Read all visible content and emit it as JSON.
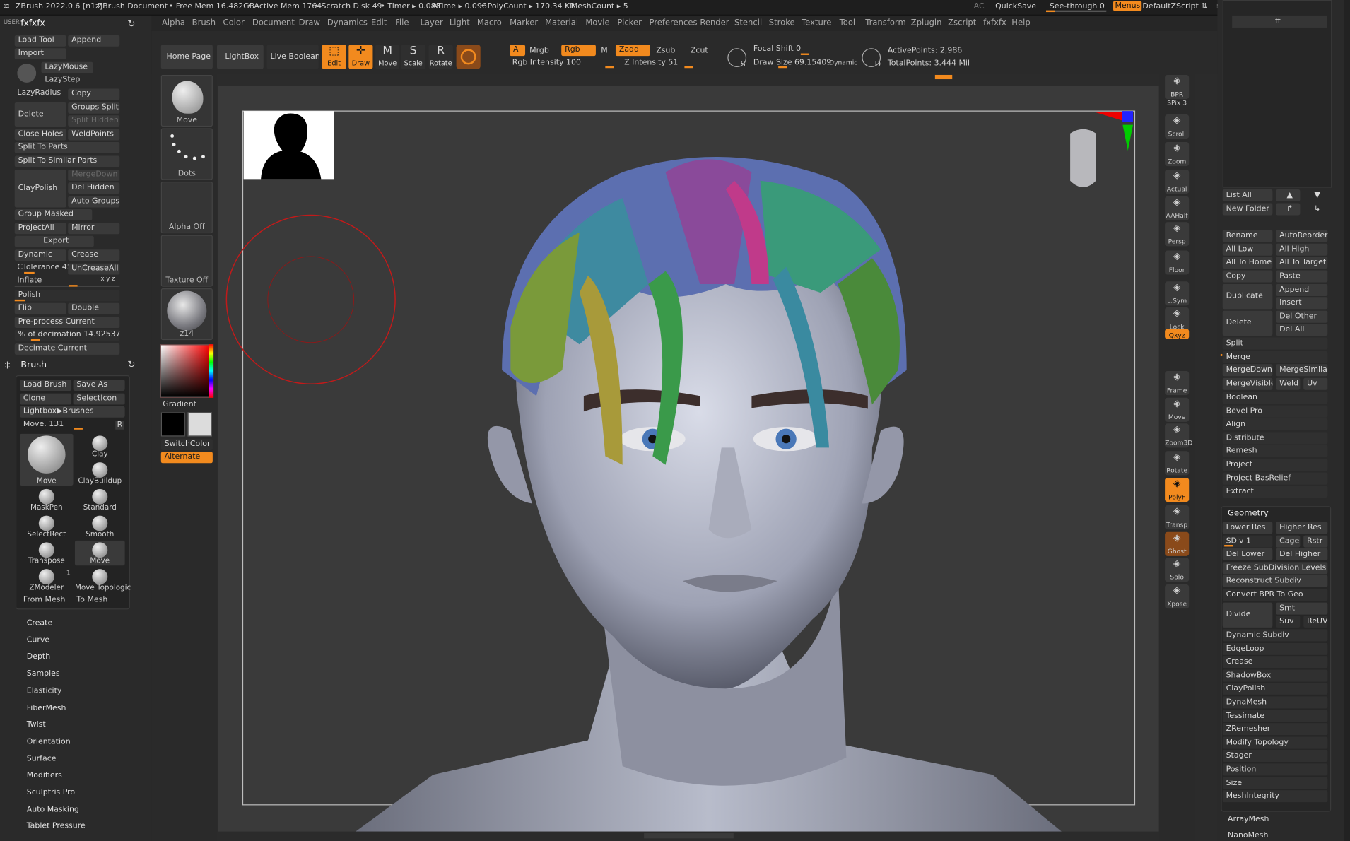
{
  "titlebar": {
    "app": "ZBrush 2022.0.6 [n1z]",
    "doc": "ZBrush Document",
    "free_mem": "• Free Mem 16.482GB",
    "active_mem": "• Active Mem 1764",
    "scratch": "• Scratch Disk 49",
    "timer": "• Timer ▸ 0.088",
    "atime": "ATime ▸ 0.096",
    "polycount": "• PolyCount ▸ 170.34 KP",
    "meshcount": "• MeshCount ▸ 5",
    "ac": "AC",
    "quicksave": "QuickSave",
    "see_through": "See-through   0",
    "menus": "Menus",
    "default_script": "DefaultZScript"
  },
  "menu": [
    "Alpha",
    "Brush",
    "Color",
    "Document",
    "Draw",
    "Dynamics",
    "Edit",
    "File",
    "Layer",
    "Light",
    "Macro",
    "Marker",
    "Material",
    "Movie",
    "Picker",
    "Preferences",
    "Render",
    "Stencil",
    "Stroke",
    "Texture",
    "Tool",
    "Transform",
    "Zplugin",
    "Zscript",
    "fxfxfx",
    "Help"
  ],
  "left": {
    "user": "USER",
    "title": "fxfxfx",
    "load_tool": "Load Tool",
    "append": "Append",
    "import": "Import",
    "lazymouse": "LazyMouse",
    "lazystep": "LazyStep",
    "lazyradius": "LazyRadius",
    "copy": "Copy",
    "delete": "Delete",
    "groups_split": "Groups Split",
    "split_hidden": "Split Hidden",
    "close_holes": "Close Holes",
    "weldpoints": "WeldPoints",
    "split_to_parts": "Split To Parts",
    "split_similar": "Split To Similar Parts",
    "claypolish": "ClayPolish",
    "mergedown": "MergeDown",
    "del_hidden": "Del Hidden",
    "auto_groups": "Auto Groups",
    "group_masked": "Group Masked",
    "projectall": "ProjectAll",
    "mirror": "Mirror",
    "export": "Export",
    "dynamic": "Dynamic",
    "crease": "Crease",
    "ctolerance": "CTolerance 45",
    "uncreaseall": "UnCreaseAll",
    "inflate": "Inflate",
    "xyz": "x y z",
    "polish": "Polish",
    "flip": "Flip",
    "double": "Double",
    "preprocess": "Pre-process Current",
    "decimation": "% of decimation  14.92537",
    "decimate": "Decimate Current",
    "brush": "Brush",
    "load_brush": "Load Brush",
    "save_as": "Save As",
    "clone": "Clone",
    "selecticon": "SelectIcon",
    "lightbox_brushes": "Lightbox▶Brushes",
    "move_val": "Move.  131",
    "r": "R",
    "from_mesh": "From Mesh",
    "to_mesh": "To Mesh",
    "brushes": [
      {
        "name": "Move",
        "icon": "move-brush-icon"
      },
      {
        "name": "Clay",
        "icon": "clay-brush-icon"
      },
      {
        "name": "ClayBuildup",
        "icon": "claybuildup-brush-icon"
      },
      {
        "name": "MaskPen",
        "icon": "maskpen-brush-icon"
      },
      {
        "name": "Standard",
        "icon": "standard-brush-icon"
      },
      {
        "name": "SelectRect",
        "icon": "selectrect-brush-icon"
      },
      {
        "name": "Smooth",
        "icon": "smooth-brush-icon"
      },
      {
        "name": "Transpose",
        "icon": "transpose-brush-icon"
      },
      {
        "name": "Move",
        "icon": "move-brush-icon"
      },
      {
        "name": "ZModeler",
        "icon": "zmodeler-brush-icon"
      },
      {
        "name": "Move Topologic",
        "icon": "move-topologic-brush-icon"
      }
    ],
    "zmodeler_count": "1",
    "subs": [
      "Create",
      "Curve",
      "Depth",
      "Samples",
      "Elasticity",
      "FiberMesh",
      "Twist",
      "Orientation",
      "Surface",
      "Modifiers",
      "Sculptris Pro",
      "Auto Masking",
      "Tablet Pressure"
    ]
  },
  "tray": {
    "move": "Move",
    "dots": "Dots",
    "alpha_off": "Alpha Off",
    "texture_off": "Texture Off",
    "z14": "z14",
    "gradient": "Gradient",
    "switchcolor": "SwitchColor",
    "alternate": "Alternate"
  },
  "tools": {
    "home_page": "Home Page",
    "lightbox": "LightBox",
    "live_boolean": "Live Boolean",
    "edit": "Edit",
    "draw": "Draw",
    "move": "Move",
    "scale": "Scale",
    "rotate": "Rotate",
    "a": "A",
    "mrgb": "Mrgb",
    "rgb": "Rgb",
    "m": "M",
    "zadd": "Zadd",
    "zsub": "Zsub",
    "zcut": "Zcut",
    "rgb_intensity": "Rgb Intensity 100",
    "z_intensity": "Z Intensity 51",
    "focal_shift": "Focal Shift 0",
    "draw_size": "Draw Size 69.15409",
    "dynamic": "Dynamic",
    "active_points": "ActivePoints: 2,986",
    "total_points": "TotalPoints: 3.444 Mil",
    "s": "S",
    "d": "D"
  },
  "shelf": [
    {
      "label": "BPR",
      "sub": "SPix 3"
    },
    {
      "label": "Scroll"
    },
    {
      "label": "Zoom"
    },
    {
      "label": "Actual"
    },
    {
      "label": "AAHalf"
    },
    {
      "label": "Persp"
    },
    {
      "label": "Floor"
    },
    {
      "label": "L.Sym"
    },
    {
      "label": "Lock"
    },
    {
      "label": "Qxyz"
    },
    {
      "label": "Frame"
    },
    {
      "label": "Move"
    },
    {
      "label": "Zoom3D"
    },
    {
      "label": "Rotate"
    },
    {
      "label": "PolyF"
    },
    {
      "label": "Transp"
    },
    {
      "label": "Ghost"
    },
    {
      "label": "Solo"
    },
    {
      "label": "Xpose"
    }
  ],
  "right": {
    "ff": "ff",
    "list_all": "List All",
    "new_folder": "New Folder",
    "rename": "Rename",
    "autoreorder": "AutoReorder",
    "all_low": "All Low",
    "all_high": "All High",
    "all_to_home": "All To Home",
    "all_to_target": "All To Target",
    "copy": "Copy",
    "paste": "Paste",
    "append": "Append",
    "duplicate": "Duplicate",
    "insert": "Insert",
    "delete": "Delete",
    "del_other": "Del Other",
    "del_all": "Del All",
    "split": "Split",
    "merge": "Merge",
    "mergedown": "MergeDown",
    "mergesimilar": "MergeSimilar",
    "mergevisible": "MergeVisible",
    "weld": "Weld",
    "uv": "Uv",
    "items": [
      "Boolean",
      "Bevel Pro",
      "Align",
      "Distribute",
      "Remesh",
      "Project",
      "Project BasRelief",
      "Extract"
    ],
    "geometry": "Geometry",
    "lower_res": "Lower Res",
    "higher_res": "Higher Res",
    "sdiv": "SDiv 1",
    "cage": "Cage",
    "rstr": "Rstr",
    "del_lower": "Del Lower",
    "del_higher": "Del Higher",
    "freeze": "Freeze SubDivision Levels",
    "reconstruct": "Reconstruct Subdiv",
    "convert_bpr": "Convert BPR To Geo",
    "divide": "Divide",
    "smt": "Smt",
    "suv": "Suv",
    "reuv": "ReUV",
    "geo_items": [
      "Dynamic Subdiv",
      "EdgeLoop",
      "Crease",
      "ShadowBox",
      "ClayPolish",
      "DynaMesh",
      "Tessimate",
      "ZRemesher",
      "Modify Topology",
      "Stager",
      "Position",
      "Size",
      "MeshIntegrity"
    ],
    "arraymesh": "ArrayMesh",
    "nanomesh": "NanoMesh"
  }
}
